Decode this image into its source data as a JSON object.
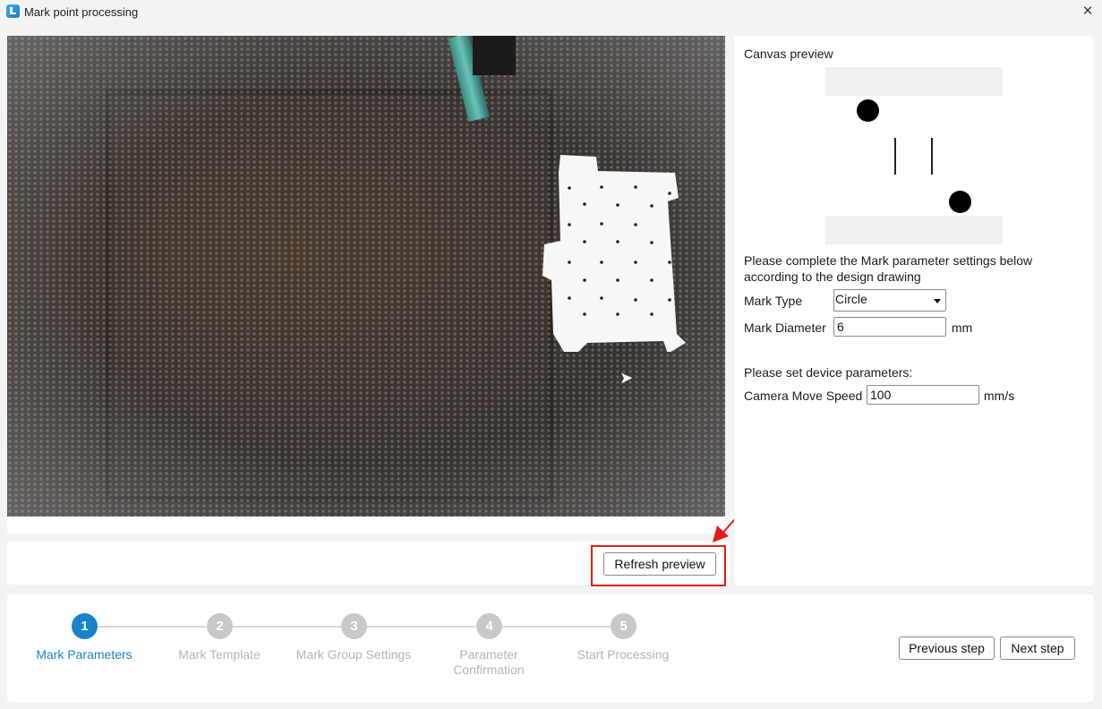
{
  "window": {
    "title": "Mark point processing",
    "close_icon": "×"
  },
  "camera": {
    "cursor_icon": "➤"
  },
  "actions": {
    "refresh_label": "Refresh preview"
  },
  "side": {
    "canvas_title": "Canvas preview",
    "instruction": "Please complete the Mark parameter settings below according to the design drawing",
    "mark_type_label": "Mark Type",
    "mark_type_value": "Circle",
    "mark_diameter_label": "Mark Diameter",
    "mark_diameter_value": "6",
    "mark_diameter_unit": "mm",
    "device_title": "Please set device parameters:",
    "camera_speed_label": "Camera Move Speed",
    "camera_speed_value": "100",
    "camera_speed_unit": "mm/s"
  },
  "steps": [
    {
      "number": "1",
      "label": "Mark Parameters"
    },
    {
      "number": "2",
      "label": "Mark Template"
    },
    {
      "number": "3",
      "label": "Mark Group Settings"
    },
    {
      "number": "4",
      "label": "Parameter Confirmation"
    },
    {
      "number": "5",
      "label": "Start Processing"
    }
  ],
  "nav": {
    "previous_label": "Previous step",
    "next_label": "Next step"
  },
  "colors": {
    "accent": "#1983c9",
    "highlight": "#e21b1b"
  }
}
